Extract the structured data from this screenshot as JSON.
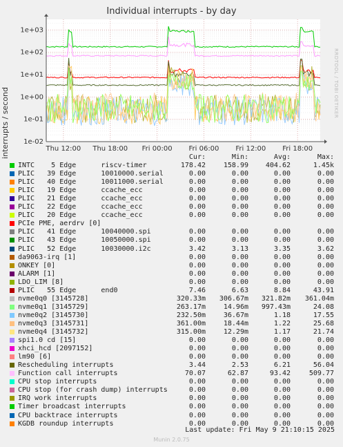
{
  "chart_data": {
    "type": "line",
    "title": "Individual interrupts - by day",
    "ylabel": "interrupts / second",
    "yscale": "log",
    "ylim": [
      0.01,
      3000
    ],
    "y_ticks": [
      "1e-02",
      "1e-01",
      "1e+00",
      "1e+01",
      "1e+02",
      "1e+03"
    ],
    "x_ticks": [
      "Thu 12:00",
      "Thu 18:00",
      "Fri 00:00",
      "Fri 06:00",
      "Fri 12:00",
      "Fri 18:00"
    ],
    "grid": true,
    "x_hours": [
      0,
      6,
      12,
      18,
      24,
      30
    ],
    "x_range_hours": [
      -2.2,
      32.9
    ],
    "series": [
      {
        "name": "INTC    5 Edge      riscv-timer",
        "color": "#00cc00",
        "level": 178,
        "busy": [
          [
            0.5,
            1.2,
            1000
          ],
          [
            13.3,
            16.7,
            1450
          ],
          [
            30.3,
            32.0,
            1300
          ]
        ],
        "busy_base": 800
      },
      {
        "name": "Function call interrupts",
        "color": "#ff99ff",
        "level": 70,
        "busy": [
          [
            0.5,
            1.2,
            250
          ],
          [
            13.3,
            16.7,
            510
          ],
          [
            30.3,
            32.0,
            300
          ]
        ],
        "busy_base": 180
      },
      {
        "name": "PCIe PME, aerdrv [0]",
        "color": "#ff0000",
        "level": 7.5,
        "busy": [
          [
            0.5,
            1.2,
            40
          ],
          [
            13.3,
            16.7,
            44
          ],
          [
            30.3,
            32.0,
            44
          ]
        ],
        "busy_base": 12
      },
      {
        "name": "Rescheduling interrupts",
        "color": "#556b2f",
        "level": 3.4,
        "busy": [
          [
            0.5,
            1.2,
            56
          ],
          [
            13.3,
            16.7,
            40
          ],
          [
            30.3,
            32.0,
            50
          ]
        ],
        "busy_base": 8
      },
      {
        "name": "nvme0q0 [3145728]",
        "color": "#b8b840",
        "level": 0.3,
        "busy": [
          [
            0.5,
            1.2,
            20
          ],
          [
            13.3,
            16.7,
            25
          ],
          [
            30.3,
            32.0,
            25
          ]
        ],
        "busy_base": 2
      },
      {
        "name": "nvme0q1 [3145729]",
        "color": "#ffcc66",
        "level": 0.26,
        "busy": [
          [
            0.5,
            1.2,
            24
          ],
          [
            13.3,
            16.7,
            20
          ],
          [
            30.3,
            32.0,
            20
          ]
        ],
        "busy_base": 2
      },
      {
        "name": "nvme0q2 [3145730]",
        "color": "#99ccff",
        "level": 0.23,
        "busy": [
          [
            0.5,
            1.2,
            17
          ],
          [
            13.3,
            16.7,
            10
          ],
          [
            30.3,
            32.0,
            12
          ]
        ],
        "busy_base": 1
      },
      {
        "name": "nvme0q3 [3145731]",
        "color": "#ffcc99",
        "level": 0.36,
        "busy": [
          [
            0.5,
            1.2,
            25
          ],
          [
            13.3,
            16.7,
            12
          ],
          [
            30.3,
            32.0,
            15
          ]
        ],
        "busy_base": 2
      },
      {
        "name": "nvme0q4 [3145732]",
        "color": "#99ff66",
        "level": 0.31,
        "busy": [
          [
            0.5,
            1.2,
            21
          ],
          [
            13.3,
            16.7,
            10
          ],
          [
            30.3,
            32.0,
            14
          ]
        ],
        "busy_base": 2
      }
    ]
  },
  "legend": {
    "headers": {
      "cur": "Cur:",
      "min": "Min:",
      "avg": "Avg:",
      "max": "Max:"
    },
    "rows": [
      {
        "color": "#00cc00",
        "name": "INTC    5 Edge      riscv-timer",
        "cur": "178.42",
        "min": "158.99",
        "avg": "404.62",
        "max": "1.45k"
      },
      {
        "color": "#0066b3",
        "name": "PLIC   39 Edge      10010000.serial",
        "cur": "0.00",
        "min": "0.00",
        "avg": "0.00",
        "max": "0.00"
      },
      {
        "color": "#ff8000",
        "name": "PLIC   40 Edge      10011000.serial",
        "cur": "0.00",
        "min": "0.00",
        "avg": "0.00",
        "max": "0.00"
      },
      {
        "color": "#ffcc00",
        "name": "PLIC   19 Edge      ccache_ecc",
        "cur": "0.00",
        "min": "0.00",
        "avg": "0.00",
        "max": "0.00"
      },
      {
        "color": "#330099",
        "name": "PLIC   21 Edge      ccache_ecc",
        "cur": "0.00",
        "min": "0.00",
        "avg": "0.00",
        "max": "0.00"
      },
      {
        "color": "#990099",
        "name": "PLIC   22 Edge      ccache_ecc",
        "cur": "0.00",
        "min": "0.00",
        "avg": "0.00",
        "max": "0.00"
      },
      {
        "color": "#ccff00",
        "name": "PLIC   20 Edge      ccache_ecc",
        "cur": "0.00",
        "min": "0.00",
        "avg": "0.00",
        "max": "0.00"
      },
      {
        "color": "#ff0000",
        "name": "PCIe PME, aerdrv [0]",
        "cur": "",
        "min": "",
        "avg": "",
        "max": ""
      },
      {
        "color": "#808080",
        "name": "PLIC   41 Edge      10040000.spi",
        "cur": "0.00",
        "min": "0.00",
        "avg": "0.00",
        "max": "0.00"
      },
      {
        "color": "#008f00",
        "name": "PLIC   43 Edge      10050000.spi",
        "cur": "0.00",
        "min": "0.00",
        "avg": "0.00",
        "max": "0.00"
      },
      {
        "color": "#00487d",
        "name": "PLIC   52 Edge      10030000.i2c",
        "cur": "3.42",
        "min": "3.13",
        "avg": "3.35",
        "max": "3.62"
      },
      {
        "color": "#b35a00",
        "name": "da9063-irq [1]",
        "cur": "0.00",
        "min": "0.00",
        "avg": "0.00",
        "max": "0.00"
      },
      {
        "color": "#b38f00",
        "name": "ONKEY [0]",
        "cur": "0.00",
        "min": "0.00",
        "avg": "0.00",
        "max": "0.00"
      },
      {
        "color": "#6b006b",
        "name": "ALARM [1]",
        "cur": "0.00",
        "min": "0.00",
        "avg": "0.00",
        "max": "0.00"
      },
      {
        "color": "#8fb300",
        "name": "LDO_LIM [8]",
        "cur": "0.00",
        "min": "0.00",
        "avg": "0.00",
        "max": "0.00"
      },
      {
        "color": "#b30000",
        "name": "PLIC   55 Edge      end0",
        "cur": "7.46",
        "min": "6.63",
        "avg": "8.84",
        "max": "43.91"
      },
      {
        "color": "#bebebe",
        "name": "nvme0q0 [3145728]",
        "cur": "320.33m",
        "min": "306.67m",
        "avg": "321.82m",
        "max": "361.04m"
      },
      {
        "color": "#80ff80",
        "name": "nvme0q1 [3145729]",
        "cur": "263.17m",
        "min": "14.96m",
        "avg": "997.43m",
        "max": "24.08"
      },
      {
        "color": "#80c9ff",
        "name": "nvme0q2 [3145730]",
        "cur": "232.50m",
        "min": "36.67m",
        "avg": "1.18",
        "max": "17.55"
      },
      {
        "color": "#ffc080",
        "name": "nvme0q3 [3145731]",
        "cur": "361.00m",
        "min": "18.44m",
        "avg": "1.22",
        "max": "25.68"
      },
      {
        "color": "#ffe680",
        "name": "nvme0q4 [3145732]",
        "cur": "315.00m",
        "min": "12.29m",
        "avg": "1.17",
        "max": "21.74"
      },
      {
        "color": "#aa80ff",
        "name": "spi1.0 cd [15]",
        "cur": "0.00",
        "min": "0.00",
        "avg": "0.00",
        "max": "0.00"
      },
      {
        "color": "#ee00cc",
        "name": "xhci_hcd [2097152]",
        "cur": "0.00",
        "min": "0.00",
        "avg": "0.00",
        "max": "0.00"
      },
      {
        "color": "#ff8080",
        "name": "lm90 [6]",
        "cur": "0.00",
        "min": "0.00",
        "avg": "0.00",
        "max": "0.00"
      },
      {
        "color": "#666600",
        "name": "Rescheduling interrupts",
        "cur": "3.44",
        "min": "2.53",
        "avg": "6.21",
        "max": "56.04"
      },
      {
        "color": "#ffbfff",
        "name": "Function call interrupts",
        "cur": "70.07",
        "min": "62.87",
        "avg": "93.42",
        "max": "509.77"
      },
      {
        "color": "#00ffcc",
        "name": "CPU stop interrupts",
        "cur": "0.00",
        "min": "0.00",
        "avg": "0.00",
        "max": "0.00"
      },
      {
        "color": "#cc6699",
        "name": "CPU stop (for crash dump) interrupts",
        "cur": "0.00",
        "min": "0.00",
        "avg": "0.00",
        "max": "0.00"
      },
      {
        "color": "#999900",
        "name": "IRQ work interrupts",
        "cur": "0.00",
        "min": "0.00",
        "avg": "0.00",
        "max": "0.00"
      },
      {
        "color": "#00cc00",
        "name": "Timer broadcast interrupts",
        "cur": "0.00",
        "min": "0.00",
        "avg": "0.00",
        "max": "0.00"
      },
      {
        "color": "#0066b3",
        "name": "CPU backtrace interrupts",
        "cur": "0.00",
        "min": "0.00",
        "avg": "0.00",
        "max": "0.00"
      },
      {
        "color": "#ff8000",
        "name": "KGDB roundup interrupts",
        "cur": "0.00",
        "min": "0.00",
        "avg": "0.00",
        "max": "0.00"
      }
    ]
  },
  "footer": {
    "last_update": "Last update: Fri May  9 21:10:15 2025",
    "munin": "Munin 2.0.75",
    "side": "RRDTOOL / TOBI OETIKER"
  }
}
